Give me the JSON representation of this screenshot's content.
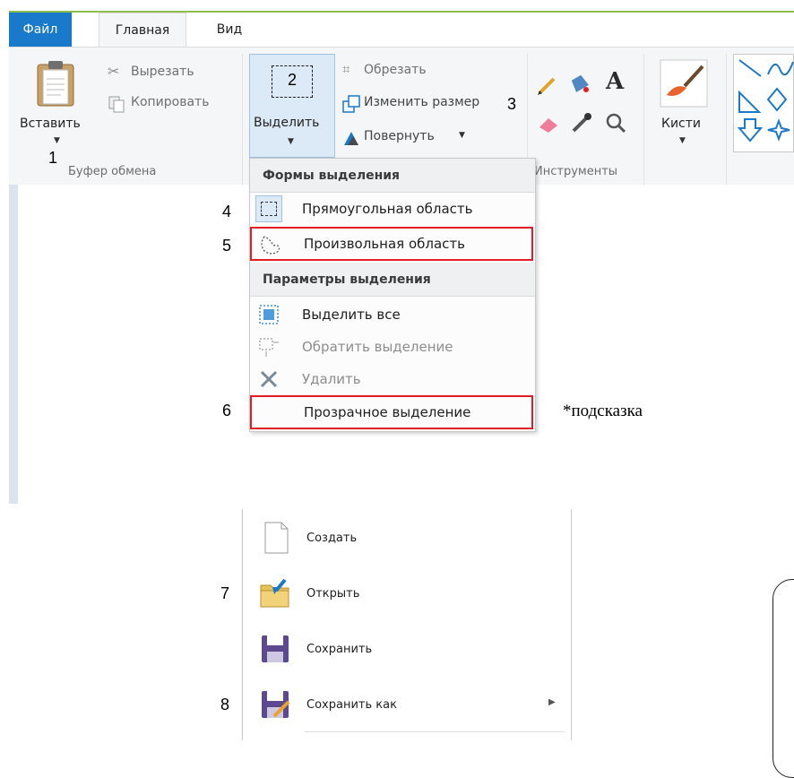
{
  "tabs": {
    "file": "Файл",
    "home": "Главная",
    "view": "Вид"
  },
  "clipboard": {
    "paste": "Вставить",
    "cut": "Вырезать",
    "copy": "Копировать",
    "group_label": "Буфер обмена"
  },
  "image": {
    "select": "Выделить",
    "crop": "Обрезать",
    "resize": "Изменить размер",
    "rotate": "Повернуть"
  },
  "tools": {
    "group_label": "Инструменты"
  },
  "brushes": {
    "label": "Кисти"
  },
  "selection_menu": {
    "shapes_header": "Формы выделения",
    "rect": "Прямоугольная область",
    "freeform": "Произвольная область",
    "options_header": "Параметры выделения",
    "select_all": "Выделить все",
    "invert": "Обратить выделение",
    "delete": "Удалить",
    "transparent": "Прозрачное выделение"
  },
  "file_menu": {
    "new": "Создать",
    "open": "Открыть",
    "save": "Сохранить",
    "save_as": "Сохранить как"
  },
  "callouts": [
    "1",
    "2",
    "3",
    "4",
    "5",
    "6",
    "7",
    "8"
  ],
  "hint": "*подсказка",
  "colors": {
    "accent": "#1979ca",
    "highlight": "#e31d24",
    "ribbon_bg": "#f5f6f7"
  }
}
